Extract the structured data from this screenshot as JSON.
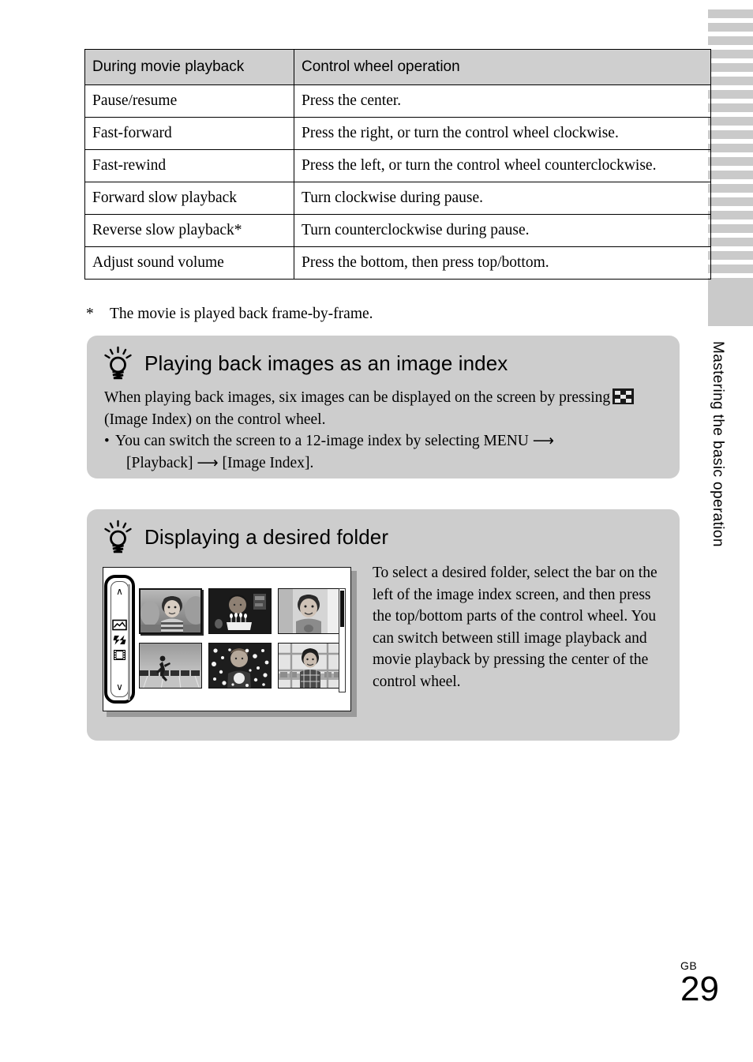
{
  "page": {
    "number": "29",
    "region_code": "GB",
    "side_title": "Mastering the basic operation"
  },
  "table": {
    "headers": [
      "During movie playback",
      "Control wheel operation"
    ],
    "rows": [
      [
        "Pause/resume",
        "Press the center."
      ],
      [
        "Fast-forward",
        "Press the right, or turn the control wheel clockwise."
      ],
      [
        "Fast-rewind",
        "Press the left, or turn the control wheel counterclockwise."
      ],
      [
        "Forward slow playback",
        "Turn clockwise during pause."
      ],
      [
        "Reverse slow playback*",
        "Turn counterclockwise during pause."
      ],
      [
        "Adjust sound volume",
        "Press the bottom, then press top/bottom."
      ]
    ],
    "footnote_mark": "*",
    "footnote_text": "The movie is played back frame-by-frame."
  },
  "tips": [
    {
      "icon": "lightbulb-icon",
      "title": "Playing back images as an image index",
      "body_part_1": "When playing back images, six images can be displayed on the screen by pressing",
      "inline_icon": "image-index-icon",
      "body_part_2": "(Image Index) on the control wheel.",
      "bullet_dot": "•",
      "bullet_text_1": "You can switch the screen to a 12-image index by selecting MENU",
      "arrow": "⟶",
      "bullet_text_2": "[Playback]",
      "bullet_text_3": "[Image Index]."
    },
    {
      "icon": "lightbulb-icon",
      "title": "Displaying a desired folder",
      "body": "To select a desired folder, select the bar on the left of the image index screen, and then press the top/bottom parts of the control wheel. You can switch between still image playback and movie playback by pressing the center of the control wheel."
    }
  ],
  "illustration": {
    "name": "image-index-screen",
    "folder_bar": {
      "up_chevron": "∧",
      "down_chevron": "∨",
      "icons": [
        "still-image-icon",
        "3d-still-image-icon",
        "movie-filmstrip-icon"
      ]
    },
    "thumbnails": [
      {
        "name": "thumbnail-boy-outdoors",
        "selected": true
      },
      {
        "name": "thumbnail-birthday-cake",
        "selected": false
      },
      {
        "name": "thumbnail-boy-indoors",
        "selected": false
      },
      {
        "name": "thumbnail-running-track",
        "selected": false
      },
      {
        "name": "thumbnail-boy-lights",
        "selected": false
      },
      {
        "name": "thumbnail-boy-window",
        "selected": false
      }
    ],
    "scrollbar": "vertical-scrollbar"
  },
  "colors": {
    "tip_box_bg": "#cdcdcd",
    "table_header_bg": "#cfcfcf",
    "tab_marker": "#cacaca",
    "text": "#000000"
  }
}
